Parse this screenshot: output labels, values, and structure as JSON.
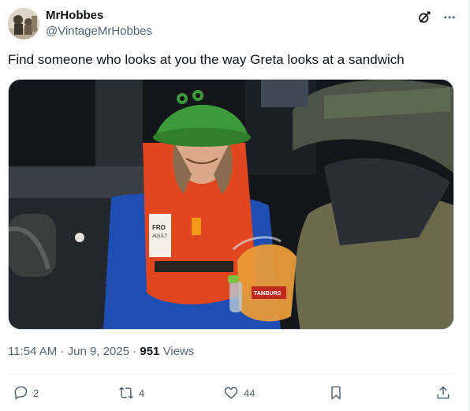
{
  "author": {
    "display_name": "MrHobbes",
    "handle": "@VintageMrHobbes",
    "avatar_icon": "sepia-portrait-avatar"
  },
  "header_icons": [
    "grok-icon",
    "more-icon"
  ],
  "tweet": {
    "text": "Find someone who looks at you the way Greta looks at a sandwich"
  },
  "media": {
    "alt_icon": "photo",
    "vest_text": [
      "FRO",
      "ADULT"
    ],
    "bag_label": "TAMBURS"
  },
  "meta": {
    "time": "11:54 AM",
    "sep1": "·",
    "date": "Jun 9, 2025",
    "sep2": "·",
    "views_count": "951",
    "views_label": "Views"
  },
  "actions": {
    "reply_count": "2",
    "retweet_count": "4",
    "like_count": "44",
    "icons": [
      "reply-icon",
      "retweet-icon",
      "like-icon",
      "bookmark-icon",
      "share-icon"
    ]
  },
  "colors": {
    "text": "#0f1419",
    "secondary": "#536471",
    "border": "#cfd9de",
    "hat_green": "#3d9a3a",
    "vest_orange": "#e2461f",
    "jacket_blue": "#1d4fb3"
  }
}
